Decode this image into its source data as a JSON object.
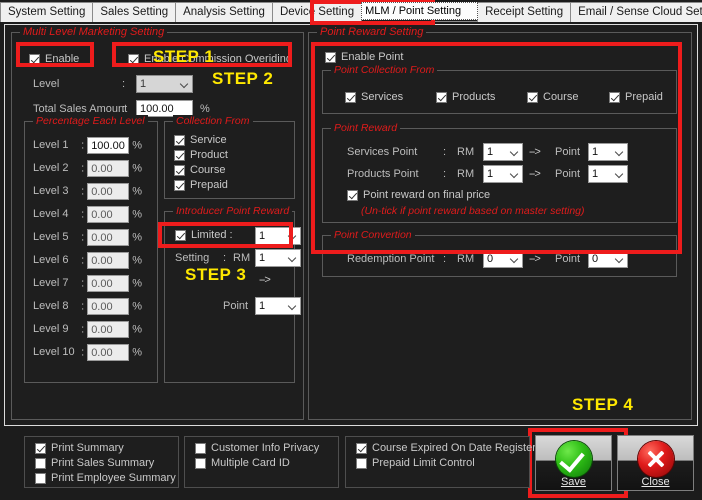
{
  "tabs": [
    {
      "label": "System Setting",
      "selected": false
    },
    {
      "label": "Sales Setting",
      "selected": false
    },
    {
      "label": "Analysis Setting",
      "selected": false
    },
    {
      "label": "Device Setting",
      "selected": false
    },
    {
      "label": "MLM / Point Setting",
      "selected": true
    },
    {
      "label": "Receipt Setting",
      "selected": false
    },
    {
      "label": "Email / Sense Cloud Setting",
      "selected": false
    }
  ],
  "mlm": {
    "legend": "Multi Level Marketing Setting",
    "enable": {
      "label": "Enable",
      "checked": true
    },
    "enable_commission": {
      "label": "Enable Commission Overiding",
      "checked": true
    },
    "level": {
      "label": "Level",
      "sep": ":",
      "value": "1"
    },
    "total_sales": {
      "label": "Total Sales Amount",
      "sep": ":",
      "value": "100.00",
      "unit": "%"
    },
    "percentage": {
      "legend": "Percentage Each Level",
      "sep": ":",
      "unit": "%",
      "rows": [
        {
          "label": "Level 1",
          "value": "100.00",
          "active": true
        },
        {
          "label": "Level 2",
          "value": "0.00",
          "active": false
        },
        {
          "label": "Level 3",
          "value": "0.00",
          "active": false
        },
        {
          "label": "Level 4",
          "value": "0.00",
          "active": false
        },
        {
          "label": "Level 5",
          "value": "0.00",
          "active": false
        },
        {
          "label": "Level 6",
          "value": "0.00",
          "active": false
        },
        {
          "label": "Level 7",
          "value": "0.00",
          "active": false
        },
        {
          "label": "Level 8",
          "value": "0.00",
          "active": false
        },
        {
          "label": "Level 9",
          "value": "0.00",
          "active": false
        },
        {
          "label": "Level 10",
          "value": "0.00",
          "active": false
        }
      ]
    },
    "collection": {
      "legend": "Collection From",
      "items": [
        {
          "label": "Service",
          "checked": true
        },
        {
          "label": "Product",
          "checked": true
        },
        {
          "label": "Course",
          "checked": true
        },
        {
          "label": "Prepaid",
          "checked": true
        }
      ]
    },
    "introducer": {
      "legend": "Introducer Point Reward",
      "limited": {
        "label": "Limited :",
        "checked": true,
        "value": "1"
      },
      "setting": {
        "label": "Setting",
        "sep": ":",
        "currency": "RM",
        "value": "1"
      },
      "arrow": "-->",
      "point": {
        "label": "Point",
        "value": "1"
      }
    }
  },
  "point": {
    "legend": "Point Reward Setting",
    "enable_point": {
      "label": "Enable Point",
      "checked": true
    },
    "collection": {
      "legend": "Point Collection From",
      "items": [
        {
          "label": "Services",
          "checked": true
        },
        {
          "label": "Products",
          "checked": true
        },
        {
          "label": "Course",
          "checked": true
        },
        {
          "label": "Prepaid",
          "checked": true
        }
      ]
    },
    "reward": {
      "legend": "Point Reward",
      "rows": [
        {
          "label": "Services Point",
          "sep": ":",
          "currency": "RM",
          "rm_value": "1",
          "arrow": "-->",
          "point_label": "Point",
          "point_value": "1"
        },
        {
          "label": "Products Point",
          "sep": ":",
          "currency": "RM",
          "rm_value": "1",
          "arrow": "-->",
          "point_label": "Point",
          "point_value": "1"
        }
      ],
      "final_price": {
        "label": "Point reward on final price",
        "checked": true
      },
      "note": "(Un-tick if point reward based on master setting)"
    },
    "convertion": {
      "legend": "Point Convertion",
      "row": {
        "label": "Redemption Point",
        "sep": ":",
        "currency": "RM",
        "rm_value": "0",
        "arrow": "-->",
        "point_label": "Point",
        "point_value": "0"
      }
    }
  },
  "steps": [
    {
      "label": "STEP 1"
    },
    {
      "label": "STEP 2"
    },
    {
      "label": "STEP 3"
    },
    {
      "label": "STEP 4"
    }
  ],
  "bottom": {
    "group1": [
      {
        "label": "Print Summary",
        "checked": true
      },
      {
        "label": "Print Sales Summary",
        "checked": false
      },
      {
        "label": "Print Employee Summary",
        "checked": false
      }
    ],
    "group2": [
      {
        "label": "Customer Info Privacy",
        "checked": false
      },
      {
        "label": "Multiple Card ID",
        "checked": false
      }
    ],
    "group3": [
      {
        "label": "Course Expired On Date Register",
        "checked": true
      },
      {
        "label": "Prepaid Limit Control",
        "checked": false
      }
    ],
    "save": {
      "label": "Save",
      "accent": "#2fbf16",
      "icon": "check-circle-icon"
    },
    "close": {
      "label": "Close",
      "accent": "#e01b1b",
      "icon": "x-circle-icon"
    }
  }
}
